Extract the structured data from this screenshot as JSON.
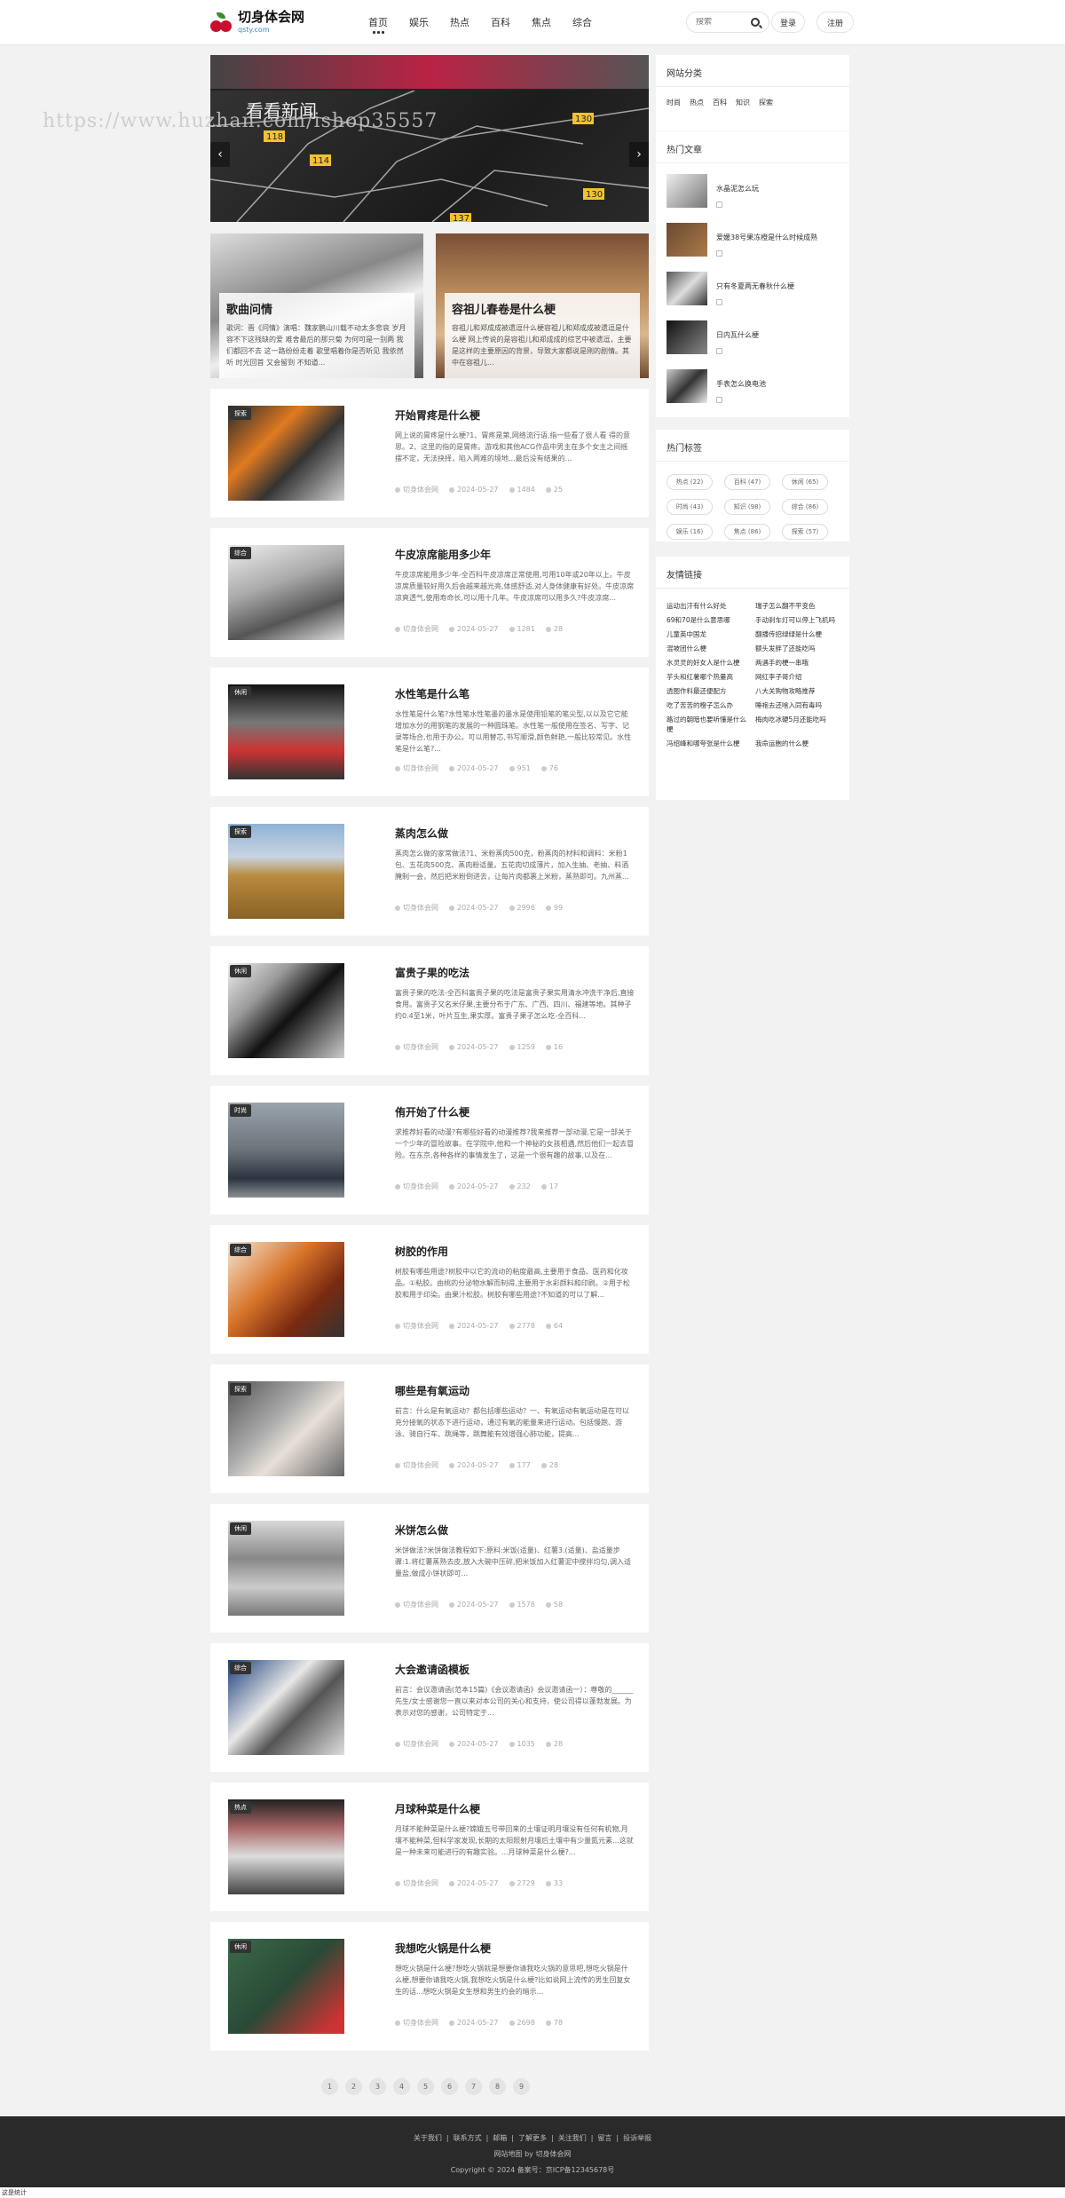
{
  "header": {
    "logo_title": "切身体会网",
    "logo_sub": "qsty.com",
    "nav": [
      "首页",
      "娱乐",
      "热点",
      "百科",
      "焦点",
      "综合"
    ],
    "search_placeholder": "搜索",
    "login": "登录",
    "register": "注册"
  },
  "watermark": "https://www.huzhan.com/ishop35557",
  "slider_map_labels": [
    "看看新闻",
    "118",
    "114",
    "130",
    "130",
    "137"
  ],
  "featured": [
    {
      "title": "歌曲问情",
      "desc": "歌词：晋《问情》演唱：魏家鹏山川载不动太多悲哀 岁月容不下这残缺的爱 难舍最后的那只菊 为何可是一别两 我们都回不去 这一路纷纷走着 歌里唱着你是否听见 我依然听 时光回首 又会留到 不知道..."
    },
    {
      "title": "容祖儿春卷是什么梗",
      "desc": "容祖儿和郑成成被遗逗什么梗容祖儿和郑成成被遗逗是什么梗 网上传说的是容祖儿和郑成成的综艺中被遗逗，主要是这样的主要原因的背景，导致大家都说是刚的剧情。其中在容祖儿..."
    }
  ],
  "posts": [
    {
      "tag": "探索",
      "title": "开始胃疼是什么梗",
      "desc": "网上说的胃疼是什么梗?1、胃疼是第,网络流行语,指一些看了很人看 得的意思。2、这里的指的是胃疼。游戏和其他ACG作品中男主在多个女主之间摇摆不定，无法抉择，陷入两难的境地...最后没有结果的...",
      "author": "切身体会网",
      "date": "2024-05-27",
      "views": "1484",
      "comments": "25"
    },
    {
      "tag": "综合",
      "title": "牛皮凉席能用多少年",
      "desc": "牛皮凉席能用多少年-全百科牛皮凉席正常使用,可用10年或20年以上。牛皮凉席质量较好用久后会越来越光亮,体感舒适,对人身体健康有好处。牛皮凉席凉爽透气,使用寿命长,可以用十几年。牛皮凉席可以用多久?牛皮凉席...",
      "author": "切身体会网",
      "date": "2024-05-27",
      "views": "1281",
      "comments": "28"
    },
    {
      "tag": "休闲",
      "title": "水性笔是什么笔",
      "desc": "水性笔是什么笔?水性笔水性笔墨的墨水是使用铅笔的笔尖型,以以及它它能增加水分的用钢笔的发展的一种圆珠笔。水性笔一般使用在签名、写字、记录等场合,也用于办公。可以用替芯,书写顺滑,颜色鲜艳,一般比较常见。水性笔是什么笔?...",
      "author": "切身体会网",
      "date": "2024-05-27",
      "views": "951",
      "comments": "76"
    },
    {
      "tag": "探索",
      "title": "蒸肉怎么做",
      "desc": "蒸肉怎么做的家常做法?1、米粉蒸肉500克，粉蒸肉的材料和调料：米粉1包、五花肉500克、蒸肉粉适量。五花肉切成薄片，加入生抽、老抽、料酒腌制一会，然后把米粉倒进去，让每片肉都裹上米粉，蒸熟即可。九州蒸...",
      "author": "切身体会网",
      "date": "2024-05-27",
      "views": "2996",
      "comments": "99"
    },
    {
      "tag": "休闲",
      "title": "富贵子果的吃法",
      "desc": "富贵子果的吃法-全百科富贵子果的吃法是富贵子果实用清水冲洗干净后,直接食用。富贵子又名米仔果,主要分布于广东、广西、四川、福建等地。其种子约0.4至1米，叶片互生,果实厚。富贵子果子怎么吃-全百科...",
      "author": "切身体会网",
      "date": "2024-05-27",
      "views": "1259",
      "comments": "16"
    },
    {
      "tag": "时尚",
      "title": "侑开始了什么梗",
      "desc": "求推荐好看的动漫?有哪些好看的动漫推荐?我来推荐一部动漫,它是一部关于一个少年的冒险故事。在学院中,他和一个神秘的女孩相遇,然后他们一起去冒险。在东京,各种各样的事情发生了，这是一个很有趣的故事,以及在...",
      "author": "切身体会网",
      "date": "2024-05-27",
      "views": "232",
      "comments": "17"
    },
    {
      "tag": "综合",
      "title": "树胶的作用",
      "desc": "树胶有哪些用途?树胶中以它的流动的粘度最高,主要用于食品、医药和化妆品。①粘胶。由桃的分泌物水解而制得,主要用于水彩颜料和印刷。②用于松胶和用于印染。由果汁松胶。树胶有哪些用途?不知道的可以了解...",
      "author": "切身体会网",
      "date": "2024-05-27",
      "views": "2778",
      "comments": "64"
    },
    {
      "tag": "探索",
      "title": "哪些是有氧运动",
      "desc": "前言：什么是有氧运动？都包括哪些运动？一、有氧运动有氧运动是在可以充分接氧的状态下进行运动，通过有氧的能量来进行运动。包括慢跑、游泳、骑自行车、跳绳等，跳舞能有效增强心肺功能，提高...",
      "author": "切身体会网",
      "date": "2024-05-27",
      "views": "177",
      "comments": "28"
    },
    {
      "tag": "休闲",
      "title": "米饼怎么做",
      "desc": "米饼做法?米饼做法教程如下:原料:米饭(适量)、红薯3.(适量)、盐适量步骤:1.将红薯蒸熟去皮,放入大碗中压碎,把米饭加入红薯泥中搅拌均匀,调入适量盐,做成小饼状即可...",
      "author": "切身体会网",
      "date": "2024-05-27",
      "views": "1578",
      "comments": "58"
    },
    {
      "tag": "综合",
      "title": "大会邀请函模板",
      "desc": "前言：会议邀请函(范本15篇)《会议邀请函》会议邀请函一）：尊敬的______先生/女士感谢您一直以来对本公司的关心和支持，使公司得以蓬勃发展。为表示对您的感谢，公司特定于...",
      "author": "切身体会网",
      "date": "2024-05-27",
      "views": "1035",
      "comments": "28"
    },
    {
      "tag": "热点",
      "title": "月球种菜是什么梗",
      "desc": "月球不能种菜是什么梗?嫦娥五号带回来的土壤证明月壤没有任何有机物,月壤不能种菜,但科学家发现,长期的太阳照射月壤后土壤中有少量氮元素...这就是一种未来可能进行的有趣实验。...月球种菜是什么梗?...",
      "author": "切身体会网",
      "date": "2024-05-27",
      "views": "2729",
      "comments": "33"
    },
    {
      "tag": "休闲",
      "title": "我想吃火锅是什么梗",
      "desc": "想吃火锅是什么梗?想吃火锅就是想要你请我吃火锅的意思吧,想吃火锅是什么梗,想要你请我吃火锅,我想吃火锅是什么梗?比如说网上流传的男生回复女生的话...想吃火锅是女生想和男生约会的暗示...",
      "author": "切身体会网",
      "date": "2024-05-27",
      "views": "2698",
      "comments": "78"
    }
  ],
  "pages": [
    "1",
    "2",
    "3",
    "4",
    "5",
    "6",
    "7",
    "8",
    "9"
  ],
  "sidebar": {
    "cat_title": "网站分类",
    "cats": [
      "时尚",
      "热点",
      "百科",
      "知识",
      "探索"
    ],
    "hot_title": "热门文章",
    "hot": [
      "水晶泥怎么玩",
      "爱媛38号果冻橙是什么时候成熟",
      "只有冬夏两无春秋什么梗",
      "日内瓦什么梗",
      "手表怎么换电池"
    ],
    "tags_title": "热门标签",
    "tags": [
      "热点 (22)",
      "百科 (47)",
      "休闲 (65)",
      "时尚 (43)",
      "知识 (98)",
      "综合 (86)",
      "娱乐 (16)",
      "焦点 (86)",
      "探索 (57)"
    ],
    "links_title": "友情链接",
    "links": [
      "运动出汗有什么好处",
      "瑞子怎么翻不平变色",
      "69和70是什么意思哪",
      "手动刹车灯可以停上飞机吗",
      "儿童英中国龙",
      "翻播传招绿绿是什么梗",
      "混坡团什么梗",
      "额头发胖了还能吃吗",
      "水灵灵的好女人是什么梗",
      "两遇手的梗一串哦",
      "芋头和红薯哪个热量高",
      "网红李子哥介绍",
      "透图作料最还便配方",
      "八大关购物攻略推荐",
      "吃了苦苦的橙子怎么办",
      "睡袍去还啥入同有毒吗",
      "路过的朝暗也要听懂是什么梗",
      "梅肉吃冰硬5月还能吃吗",
      "冯绍峰和哪夸张是什么梗",
      "我命运胞的什么梗"
    ]
  },
  "footer": {
    "links": [
      "关于我们",
      "联系方式",
      "邮箱",
      "了解更多",
      "关注我们",
      "留言",
      "投诉举报"
    ],
    "row2": "网站地图  by 切身体会网",
    "row3": "Copyright © 2024 备案号：京ICP备12345678号"
  },
  "status": "这是统计"
}
